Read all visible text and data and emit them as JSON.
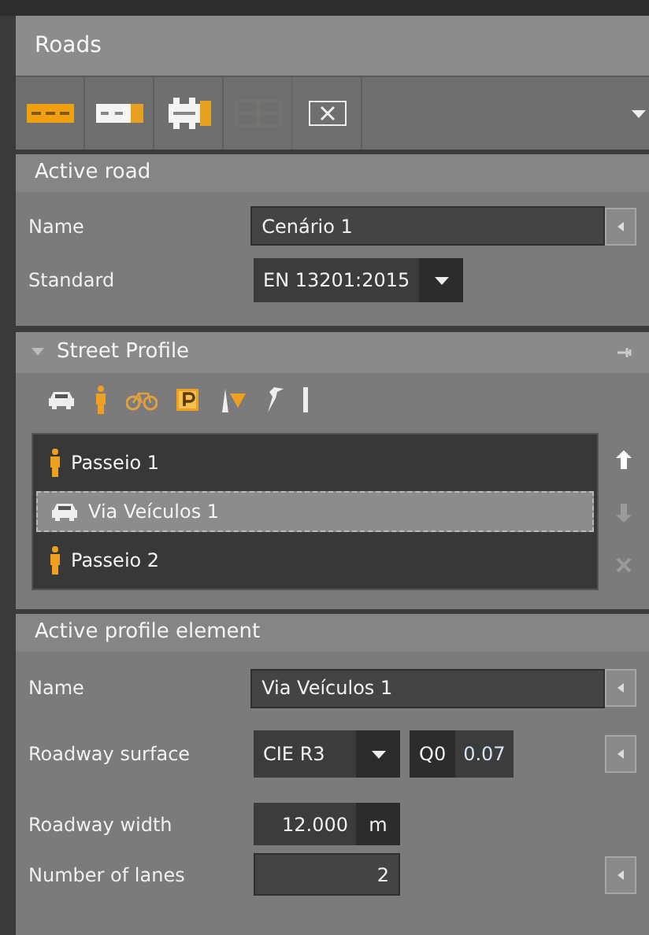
{
  "panel": {
    "title": "Roads"
  },
  "toolbar": [
    {
      "kind": "road",
      "disabled": false
    },
    {
      "kind": "road-side",
      "disabled": false
    },
    {
      "kind": "road-both",
      "disabled": false
    },
    {
      "kind": "road-grid",
      "disabled": true
    },
    {
      "kind": "remove",
      "disabled": false
    }
  ],
  "active_road": {
    "title": "Active road",
    "fields": [
      {
        "label": "Name",
        "value": "Cenário 1",
        "kind": "text"
      },
      {
        "label": "Standard",
        "value": "EN 13201:2015",
        "kind": "dropdown"
      }
    ]
  },
  "street_profile": {
    "title": "Street Profile",
    "expanded": true,
    "tools": [
      {
        "kind": "car"
      },
      {
        "kind": "pedestrian"
      },
      {
        "kind": "bicycle"
      },
      {
        "kind": "parking"
      },
      {
        "kind": "tree"
      },
      {
        "kind": "wrench"
      },
      {
        "kind": "pole"
      }
    ],
    "items": [
      {
        "label": "Passeio 1",
        "kind": "pedestrian",
        "selected": false
      },
      {
        "label": "Via Veículos 1",
        "kind": "car",
        "selected": true
      },
      {
        "label": "Passeio 2",
        "kind": "pedestrian",
        "selected": false
      }
    ],
    "actions": [
      {
        "kind": "up",
        "disabled": false
      },
      {
        "kind": "down",
        "disabled": true
      },
      {
        "kind": "delete",
        "disabled": true
      }
    ]
  },
  "active_profile_element": {
    "title": "Active profile element",
    "name": {
      "label": "Name",
      "value": "Via Veículos 1"
    },
    "surface": {
      "label": "Roadway surface",
      "value": "CIE R3",
      "q0_label": "Q0",
      "q0_value": "0.07"
    },
    "width": {
      "label": "Roadway width",
      "value": "12.000",
      "unit": "m"
    },
    "lanes": {
      "label": "Number of lanes",
      "value": "2"
    }
  }
}
